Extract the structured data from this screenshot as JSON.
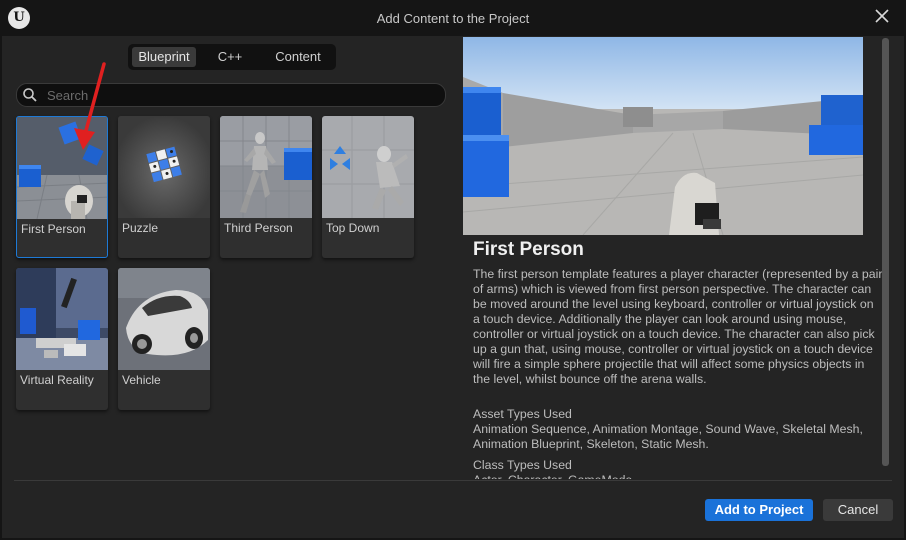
{
  "window": {
    "title": "Add Content to the Project"
  },
  "tabs": [
    {
      "label": "Blueprint",
      "active": true
    },
    {
      "label": "C++",
      "active": false
    },
    {
      "label": "Content",
      "active": false
    }
  ],
  "search": {
    "placeholder": "Search",
    "value": ""
  },
  "templates": [
    {
      "label": "First Person",
      "selected": true
    },
    {
      "label": "Puzzle",
      "selected": false
    },
    {
      "label": "Third Person",
      "selected": false
    },
    {
      "label": "Top Down",
      "selected": false
    },
    {
      "label": "Virtual Reality",
      "selected": false
    },
    {
      "label": "Vehicle",
      "selected": false
    }
  ],
  "details": {
    "title": "First Person",
    "description": "The first person template features a player character (represented by a pair of arms) which is viewed from first person perspective. The character can be moved around the level using keyboard, controller or virtual joystick on a touch device. Additionally the player can look around using mouse, controller or virtual joystick on a touch device. The character can also pick up a gun that, using mouse, controller or virtual joystick on a touch device will fire a simple sphere projectile that will affect some physics objects in the level, whilst bounce off the arena walls.",
    "asset_types_heading": "Asset Types Used",
    "asset_types": "Animation Sequence, Animation Montage, Sound Wave, Skeletal Mesh, Animation Blueprint, Skeleton, Static Mesh.",
    "class_types_heading": "Class Types Used",
    "class_types": "Actor, Character, GameMode"
  },
  "buttons": {
    "add": "Add to Project",
    "cancel": "Cancel"
  },
  "colors": {
    "accent": "#1a72d9",
    "background": "#242424",
    "titlebar": "#151515",
    "annotation_arrow": "#e02020"
  }
}
